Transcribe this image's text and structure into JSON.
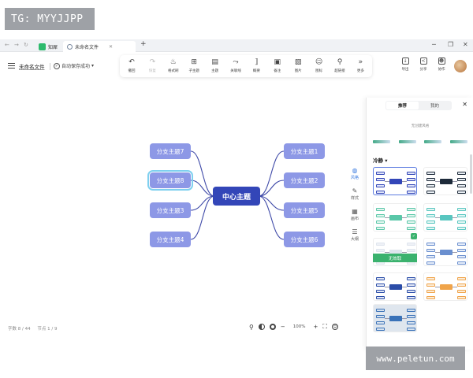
{
  "watermarks": {
    "top": "TG: MYYJJPP",
    "bottom": "www.peletun.com"
  },
  "browser": {
    "tabs": [
      {
        "label": "知犀",
        "icon": "app-logo-icon",
        "active": false
      },
      {
        "label": "未命名文件",
        "icon": "document-icon",
        "active": true
      }
    ],
    "new_tab": "+",
    "controls": [
      "─",
      "❐",
      "✕"
    ]
  },
  "header": {
    "filename": "未命名文件",
    "autosave": "自动保存成功",
    "autosave_caret": "▾"
  },
  "toolbar": {
    "tools": [
      {
        "label": "撤回",
        "icon": "undo-icon",
        "glyph": "↶",
        "disabled": false
      },
      {
        "label": "恢复",
        "icon": "redo-icon",
        "glyph": "↷",
        "disabled": true
      },
      {
        "label": "格式刷",
        "icon": "format-brush-icon",
        "glyph": "♨",
        "disabled": false
      },
      {
        "label": "子主题",
        "icon": "subtopic-icon",
        "glyph": "⊞",
        "disabled": false
      },
      {
        "label": "主题",
        "icon": "topic-icon",
        "glyph": "▤",
        "disabled": false
      },
      {
        "label": "关联线",
        "icon": "relation-line-icon",
        "glyph": "⤳",
        "disabled": false
      },
      {
        "label": "概要",
        "icon": "summary-icon",
        "glyph": "⟧",
        "disabled": false
      },
      {
        "label": "备注",
        "icon": "note-icon",
        "glyph": "▣",
        "disabled": false
      },
      {
        "label": "图片",
        "icon": "image-icon",
        "glyph": "▨",
        "disabled": false
      },
      {
        "label": "图标",
        "icon": "emoji-icon",
        "glyph": "☺",
        "disabled": false
      },
      {
        "label": "超链接",
        "icon": "link-icon",
        "glyph": "⚲",
        "disabled": false
      },
      {
        "label": "更多",
        "icon": "more-icon",
        "glyph": "»",
        "disabled": false
      }
    ],
    "right_tools": [
      {
        "label": "导出",
        "icon": "export-icon",
        "glyph": "↓"
      },
      {
        "label": "分享",
        "icon": "share-icon",
        "glyph": "<"
      },
      {
        "label": "协作",
        "icon": "collaborate-icon",
        "glyph": "☻"
      }
    ]
  },
  "mindmap": {
    "center": "中心主题",
    "left_branches": [
      "分支主题7",
      "分支主题8",
      "分支主题3",
      "分支主题4"
    ],
    "right_branches": [
      "分支主题1",
      "分支主题2",
      "分支主题5",
      "分支主题6"
    ],
    "selected": "分支主题8",
    "colors": {
      "center": "#3346b8",
      "branch": "#8d98e6",
      "line": "#3f4aa8",
      "selection": "#7fd0ef"
    }
  },
  "statusbar": {
    "words": "字数 8 / 44",
    "nodes": "节点 1 / 9",
    "zoom": "100%",
    "zoom_minus": "−",
    "zoom_plus": "+"
  },
  "side_tabs": [
    {
      "label": "风格",
      "icon": "palette-icon",
      "glyph": "◍",
      "active": true
    },
    {
      "label": "样式",
      "icon": "style-icon",
      "glyph": "✎",
      "active": false
    },
    {
      "label": "画布",
      "icon": "canvas-icon",
      "glyph": "▦",
      "active": false
    },
    {
      "label": "大纲",
      "icon": "outline-icon",
      "glyph": "☰",
      "active": false
    }
  ],
  "panel": {
    "tabs": [
      "推荐",
      "我的"
    ],
    "active_tab": "推荐",
    "close": "✕",
    "no_style": "无创建风格",
    "category": "冷静",
    "category_caret": "▾",
    "trial_label": "无效取",
    "badge": "✓"
  }
}
